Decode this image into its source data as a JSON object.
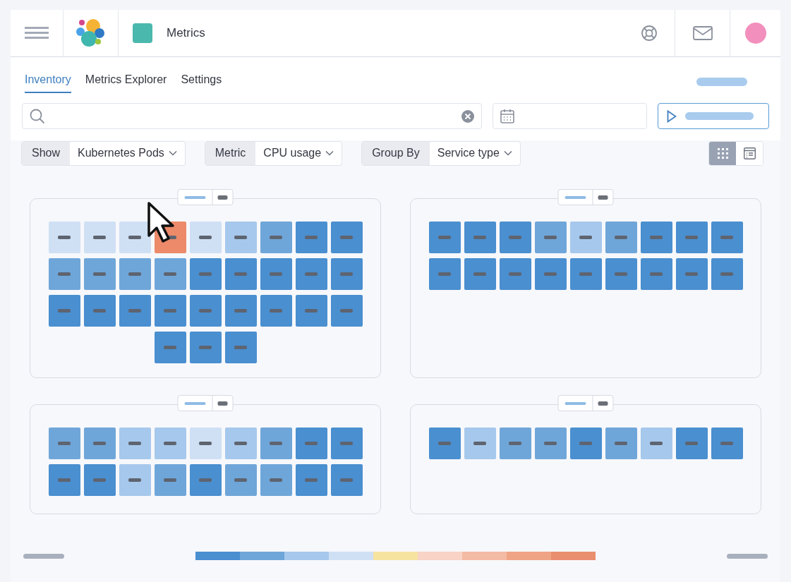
{
  "header": {
    "title": "Metrics"
  },
  "tabs": [
    {
      "label": "Inventory",
      "selected": true
    },
    {
      "label": "Metrics Explorer",
      "selected": false
    },
    {
      "label": "Settings",
      "selected": false
    }
  ],
  "filters": [
    {
      "label": "Show",
      "value": "Kubernetes Pods"
    },
    {
      "label": "Metric",
      "value": "CPU usage"
    },
    {
      "label": "Group By",
      "value": "Service type"
    }
  ],
  "view_toggle": [
    {
      "kind": "grid",
      "selected": true
    },
    {
      "kind": "list",
      "selected": false
    }
  ],
  "groups": [
    {
      "tiles": [
        {
          "color": "#cfe0f4"
        },
        {
          "color": "#cfe0f4"
        },
        {
          "color": "#cfe0f4"
        },
        {
          "color": "#ec8a6a"
        },
        {
          "color": "#cfe0f4"
        },
        {
          "color": "#a6c8ec"
        },
        {
          "color": "#6fa6d9"
        },
        {
          "color": "#4a8fd0"
        },
        {
          "color": "#4a8fd0"
        },
        {
          "color": "#6fa6d9"
        },
        {
          "color": "#6fa6d9"
        },
        {
          "color": "#6fa6d9"
        },
        {
          "color": "#6fa6d9"
        },
        {
          "color": "#4a8fd0"
        },
        {
          "color": "#4a8fd0"
        },
        {
          "color": "#4a8fd0"
        },
        {
          "color": "#4a8fd0"
        },
        {
          "color": "#4a8fd0"
        },
        {
          "color": "#4a8fd0"
        },
        {
          "color": "#4a8fd0"
        },
        {
          "color": "#4a8fd0"
        },
        {
          "color": "#4a8fd0"
        },
        {
          "color": "#4a8fd0"
        },
        {
          "color": "#4a8fd0"
        },
        {
          "color": "#4a8fd0"
        },
        {
          "color": "#4a8fd0"
        },
        {
          "color": "#4a8fd0"
        },
        {
          "color": "#4a8fd0"
        },
        {
          "color": "#4a8fd0"
        },
        {
          "color": "#4a8fd0"
        }
      ]
    },
    {
      "tiles": [
        {
          "color": "#4a8fd0"
        },
        {
          "color": "#4a8fd0"
        },
        {
          "color": "#4a8fd0"
        },
        {
          "color": "#6fa6d9"
        },
        {
          "color": "#a6c8ec"
        },
        {
          "color": "#6fa6d9"
        },
        {
          "color": "#4a8fd0"
        },
        {
          "color": "#4a8fd0"
        },
        {
          "color": "#4a8fd0"
        },
        {
          "color": "#4a8fd0"
        },
        {
          "color": "#4a8fd0"
        },
        {
          "color": "#4a8fd0"
        },
        {
          "color": "#4a8fd0"
        },
        {
          "color": "#4a8fd0"
        },
        {
          "color": "#4a8fd0"
        },
        {
          "color": "#4a8fd0"
        },
        {
          "color": "#4a8fd0"
        },
        {
          "color": "#4a8fd0"
        }
      ]
    },
    {
      "tiles": [
        {
          "color": "#6fa6d9"
        },
        {
          "color": "#6fa6d9"
        },
        {
          "color": "#a6c8ec"
        },
        {
          "color": "#a6c8ec"
        },
        {
          "color": "#cfe0f4"
        },
        {
          "color": "#a6c8ec"
        },
        {
          "color": "#6fa6d9"
        },
        {
          "color": "#4a8fd0"
        },
        {
          "color": "#4a8fd0"
        },
        {
          "color": "#4a8fd0"
        },
        {
          "color": "#4a8fd0"
        },
        {
          "color": "#a6c8ec"
        },
        {
          "color": "#6fa6d9"
        },
        {
          "color": "#4a8fd0"
        },
        {
          "color": "#6fa6d9"
        },
        {
          "color": "#6fa6d9"
        },
        {
          "color": "#4a8fd0"
        },
        {
          "color": "#4a8fd0"
        }
      ]
    },
    {
      "tiles": [
        {
          "color": "#4a8fd0"
        },
        {
          "color": "#a6c8ec"
        },
        {
          "color": "#6fa6d9"
        },
        {
          "color": "#6fa6d9"
        },
        {
          "color": "#4a8fd0"
        },
        {
          "color": "#6fa6d9"
        },
        {
          "color": "#a6c8ec"
        },
        {
          "color": "#4a8fd0"
        },
        {
          "color": "#4a8fd0"
        }
      ]
    }
  ],
  "legend": [
    {
      "color": "#4a8fd0"
    },
    {
      "color": "#6fa6d9"
    },
    {
      "color": "#a6c8ec"
    },
    {
      "color": "#cfe0f4"
    },
    {
      "color": "#f6e3a0"
    },
    {
      "color": "#f8d3c6"
    },
    {
      "color": "#f4bba4"
    },
    {
      "color": "#f0a486"
    },
    {
      "color": "#e98e6f"
    }
  ]
}
